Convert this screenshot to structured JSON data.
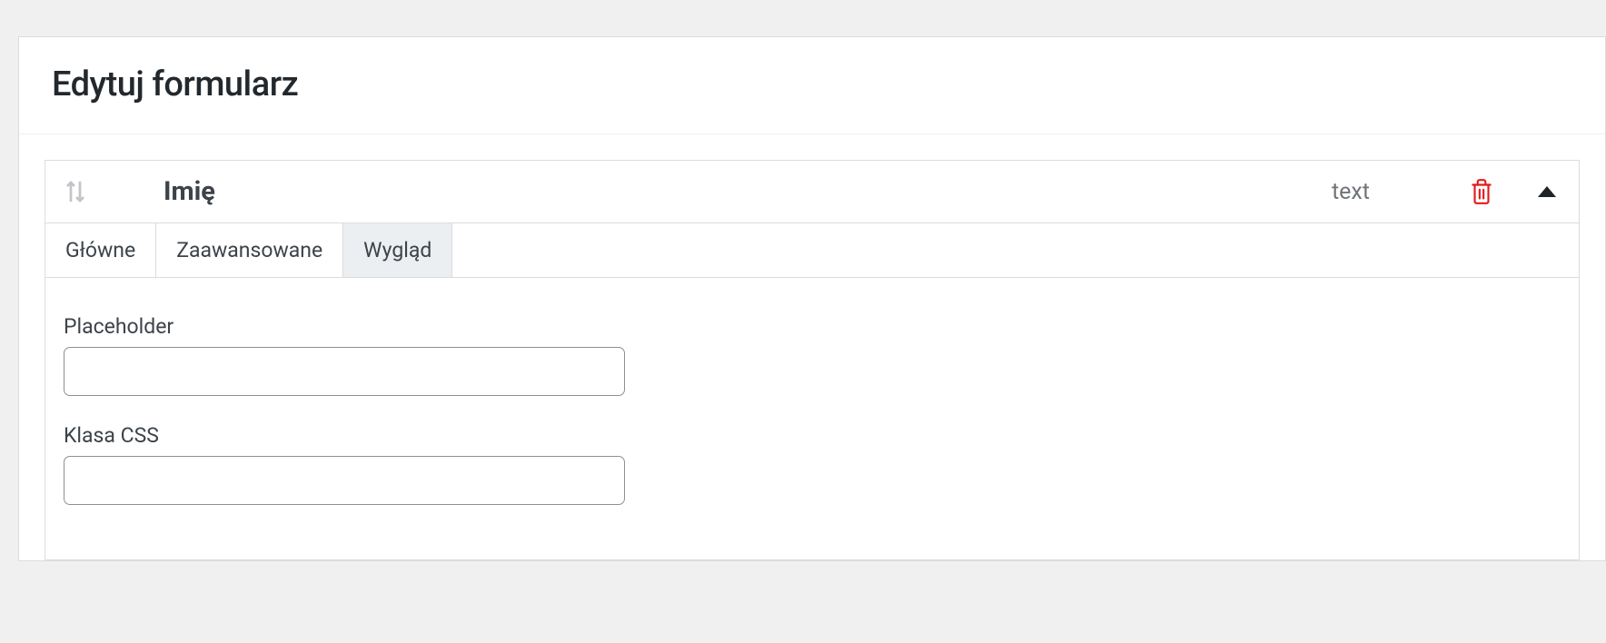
{
  "page": {
    "title": "Edytuj formularz"
  },
  "field": {
    "title": "Imię",
    "type": "text",
    "tabs": {
      "main": "Główne",
      "advanced": "Zaawansowane",
      "appearance": "Wygląd"
    },
    "appearance": {
      "placeholder_label": "Placeholder",
      "placeholder_value": "",
      "css_class_label": "Klasa CSS",
      "css_class_value": ""
    }
  }
}
